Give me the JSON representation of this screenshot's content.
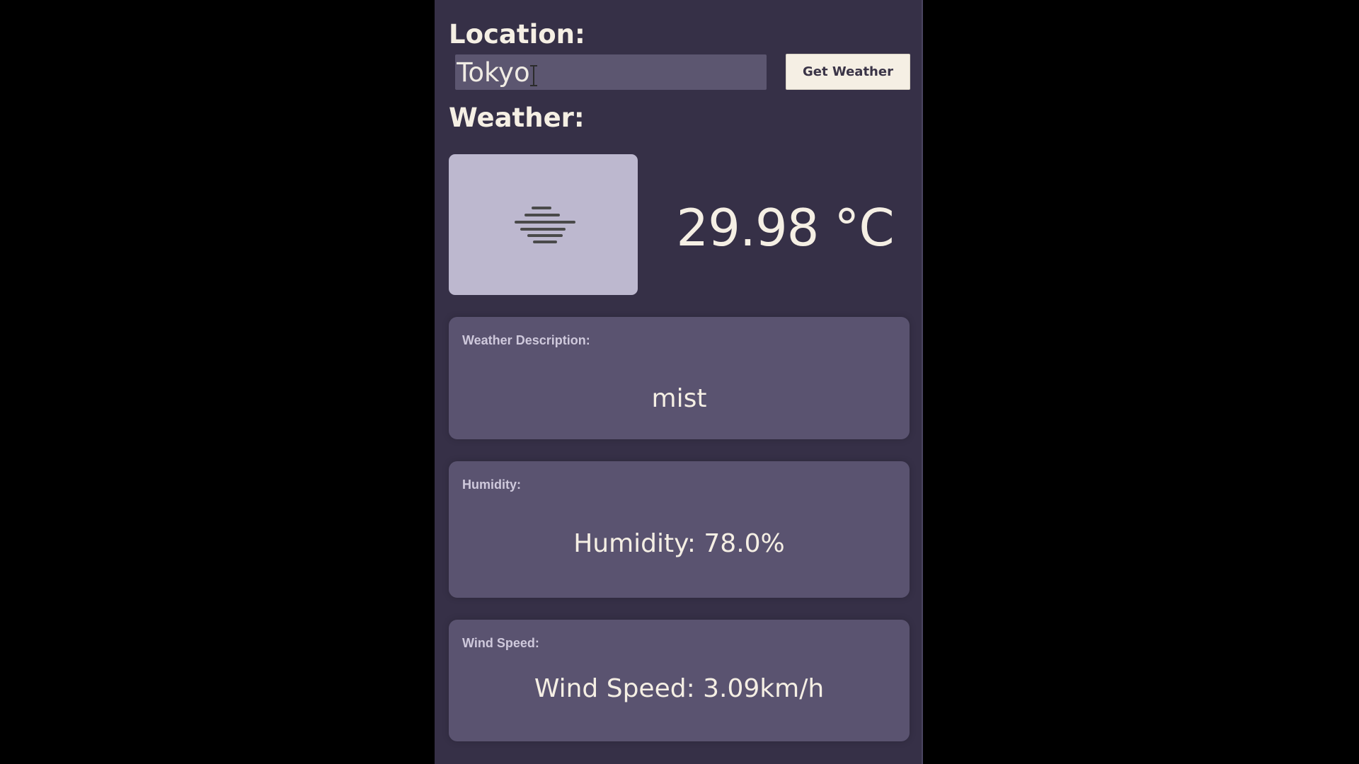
{
  "location": {
    "heading": "Location:",
    "input_value": "Tokyo",
    "input_placeholder": "",
    "button_label": "Get Weather"
  },
  "weather": {
    "heading": "Weather:",
    "icon": "mist-icon",
    "temperature": "29.98 °C"
  },
  "cards": {
    "description": {
      "label": "Weather Description:",
      "value": "mist"
    },
    "humidity": {
      "label": "Humidity:",
      "value": "Humidity: 78.0%"
    },
    "wind": {
      "label": "Wind Speed:",
      "value": "Wind Speed: 3.09km/h"
    }
  },
  "colors": {
    "app_background": "#363047",
    "card_background": "#5a5370",
    "icon_box_background": "#bdb8cf",
    "button_background": "#f5efe4",
    "text_primary": "#f5efe4"
  }
}
